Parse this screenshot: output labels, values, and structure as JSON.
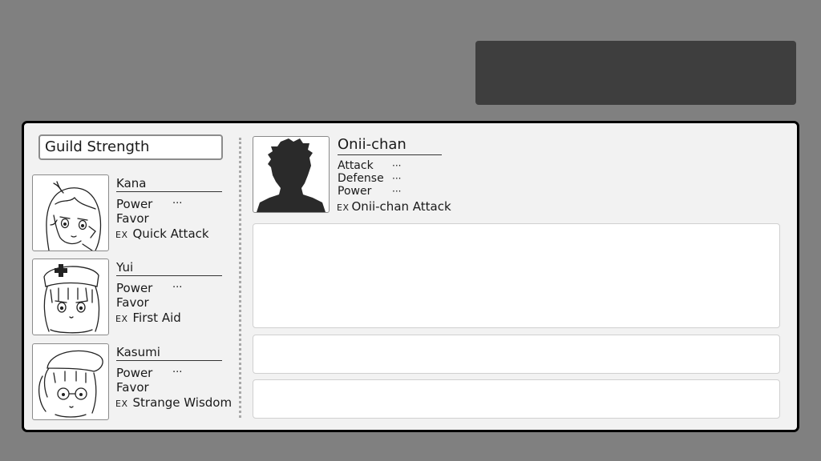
{
  "guild": {
    "title": "Guild Strength"
  },
  "characters": [
    {
      "name": "Kana",
      "stats": [
        {
          "label": "Power",
          "value": "···"
        },
        {
          "label": "Favor",
          "value": ""
        }
      ],
      "ex_tag": "EX",
      "ex_skill": "Quick Attack"
    },
    {
      "name": "Yui",
      "stats": [
        {
          "label": "Power",
          "value": "···"
        },
        {
          "label": "Favor",
          "value": ""
        }
      ],
      "ex_tag": "EX",
      "ex_skill": "First Aid"
    },
    {
      "name": "Kasumi",
      "stats": [
        {
          "label": "Power",
          "value": "···"
        },
        {
          "label": "Favor",
          "value": ""
        }
      ],
      "ex_tag": "EX",
      "ex_skill": "Strange Wisdom"
    }
  ],
  "player": {
    "name": "Onii-chan",
    "stats": [
      {
        "label": "Attack",
        "value": "···"
      },
      {
        "label": "Defense",
        "value": "···"
      },
      {
        "label": "Power",
        "value": "···"
      }
    ],
    "ex_tag": "EX",
    "ex_skill": "Onii-chan Attack"
  },
  "colors": {
    "background": "#808080",
    "top_box": "#3e3e3e",
    "panel": "#f2f2f2",
    "panel_border": "#000000"
  },
  "icons": {
    "kana_portrait": "girl-sketch-portrait-icon",
    "yui_portrait": "nurse-girl-sketch-portrait-icon",
    "kasumi_portrait": "beret-glasses-girl-sketch-portrait-icon",
    "player_portrait": "silhouette-portrait-icon"
  }
}
